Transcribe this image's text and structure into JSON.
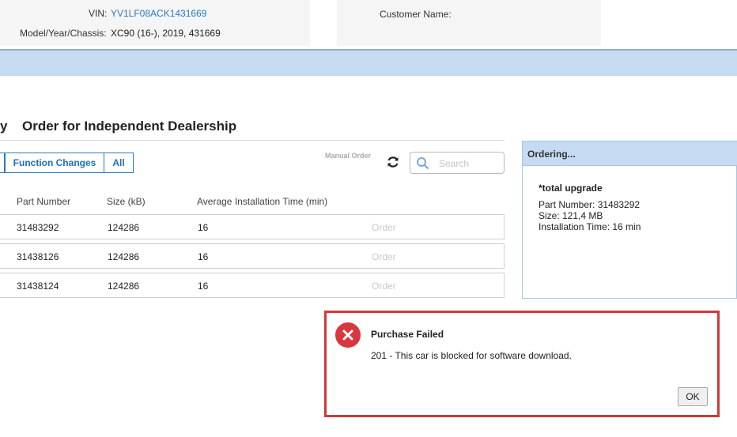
{
  "vehicle": {
    "vin_label": "VIN:",
    "vin_value": "YV1LF08ACK1431669",
    "model_label": "Model/Year/Chassis:",
    "model_value": "XC90 (16-), 2019, 431669",
    "customer_label": "Customer Name:"
  },
  "tabs": {
    "partial_tab": "y",
    "active_title": "Order for Independent Dealership"
  },
  "filters": {
    "function_changes": "Function Changes",
    "all": "All"
  },
  "toolbar": {
    "manual_order": "Manual Order",
    "search_placeholder": "Search"
  },
  "table": {
    "headers": [
      "Part Number",
      "Size (kB)",
      "Average Installation Time (min)"
    ],
    "rows": [
      {
        "part": "31483292",
        "size": "124286",
        "time": "16",
        "action": "Order"
      },
      {
        "part": "31438126",
        "size": "124286",
        "time": "16",
        "action": "Order"
      },
      {
        "part": "31438124",
        "size": "124286",
        "time": "16",
        "action": "Order"
      }
    ]
  },
  "ordering": {
    "title": "Ordering...",
    "name": "*total upgrade",
    "part_number": "Part Number: 31483292",
    "size": "Size: 121,4 MB",
    "installation": "Installation Time: 16 min"
  },
  "dialog": {
    "icon": "error-x-icon",
    "title": "Purchase Failed",
    "message": "201 - This car is blocked for software download.",
    "ok": "OK",
    "icon_color": "#d9363e",
    "border_color": "#cc3a3a"
  }
}
